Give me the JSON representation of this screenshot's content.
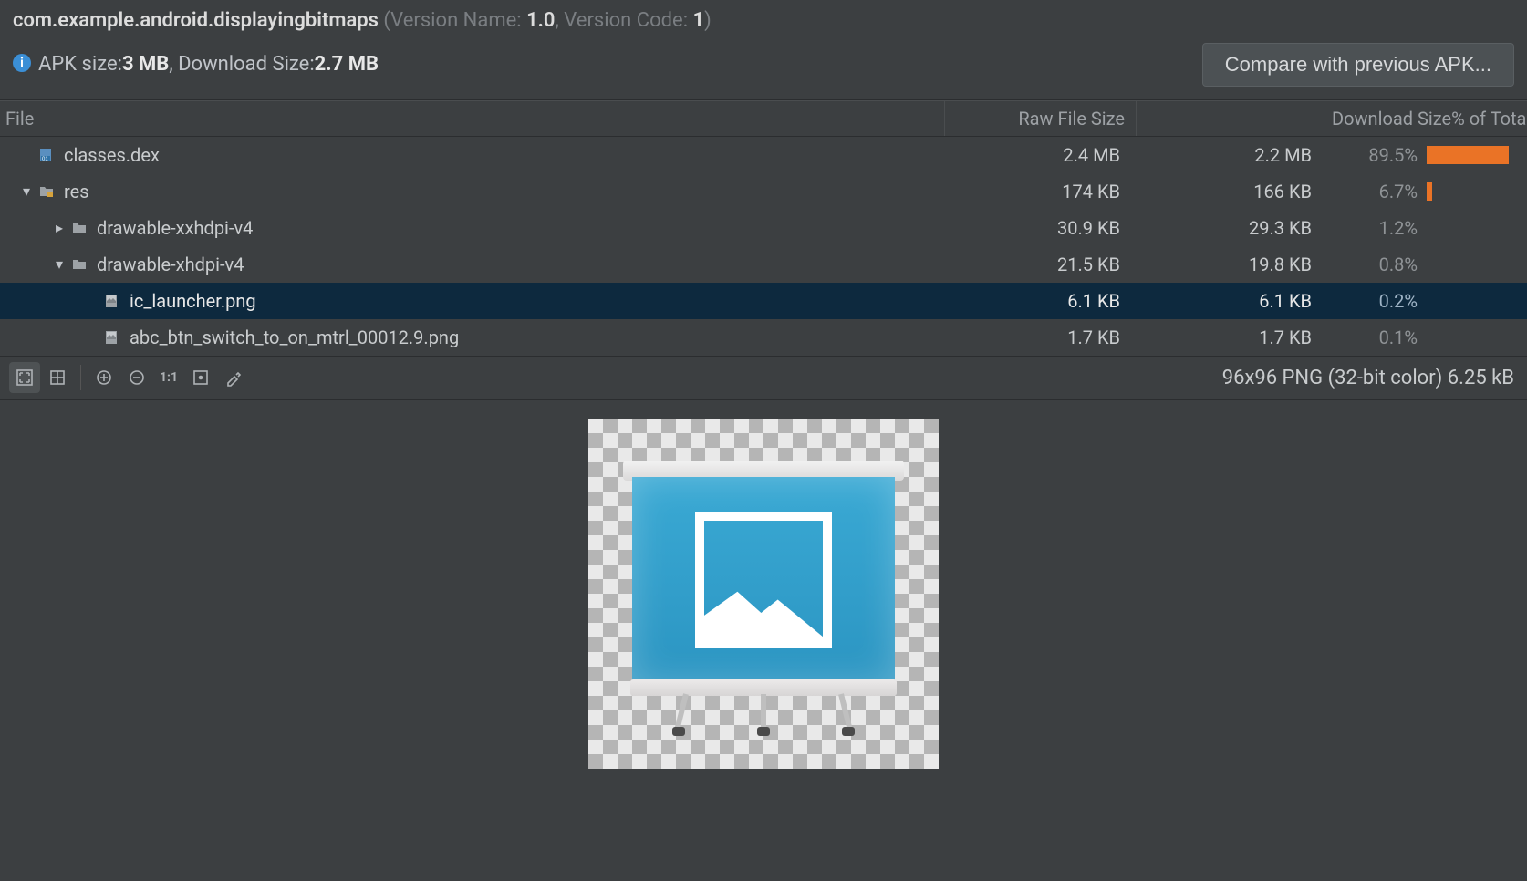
{
  "header": {
    "package_name": "com.example.android.displayingbitmaps",
    "version_name_label": " (Version Name: ",
    "version_name": "1.0",
    "version_code_label": ", Version Code: ",
    "version_code": "1",
    "close_paren": ")"
  },
  "apk": {
    "apk_size_label": "APK size: ",
    "apk_size": "3 MB",
    "download_size_label": ", Download Size: ",
    "download_size": "2.7 MB"
  },
  "actions": {
    "compare_label": "Compare with previous APK..."
  },
  "table": {
    "columns": {
      "file": "File",
      "raw": "Raw File Size",
      "download_pct": "Download Size% of Total Download ..."
    },
    "rows": [
      {
        "indent": 0,
        "chevron": "",
        "icon": "dex",
        "name": "classes.dex",
        "raw": "2.4 MB",
        "dl": "2.2 MB",
        "pct": "89.5%",
        "bar": 90,
        "selected": false
      },
      {
        "indent": 0,
        "chevron": "down",
        "icon": "folder",
        "name": "res",
        "raw": "174 KB",
        "dl": "166 KB",
        "pct": "6.7%",
        "bar": 6,
        "selected": false
      },
      {
        "indent": 1,
        "chevron": "right",
        "icon": "folder",
        "name": "drawable-xxhdpi-v4",
        "raw": "30.9 KB",
        "dl": "29.3 KB",
        "pct": "1.2%",
        "bar": 0,
        "selected": false
      },
      {
        "indent": 1,
        "chevron": "down",
        "icon": "folder",
        "name": "drawable-xhdpi-v4",
        "raw": "21.5 KB",
        "dl": "19.8 KB",
        "pct": "0.8%",
        "bar": 0,
        "selected": false
      },
      {
        "indent": 2,
        "chevron": "",
        "icon": "image",
        "name": "ic_launcher.png",
        "raw": "6.1 KB",
        "dl": "6.1 KB",
        "pct": "0.2%",
        "bar": 0,
        "selected": true
      },
      {
        "indent": 2,
        "chevron": "",
        "icon": "image",
        "name": "abc_btn_switch_to_on_mtrl_00012.9.png",
        "raw": "1.7 KB",
        "dl": "1.7 KB",
        "pct": "0.1%",
        "bar": 0,
        "selected": false
      }
    ]
  },
  "preview": {
    "info": "96x96 PNG (32-bit color) 6.25 kB",
    "toolbar": {
      "one_to_one": "1:1"
    }
  }
}
